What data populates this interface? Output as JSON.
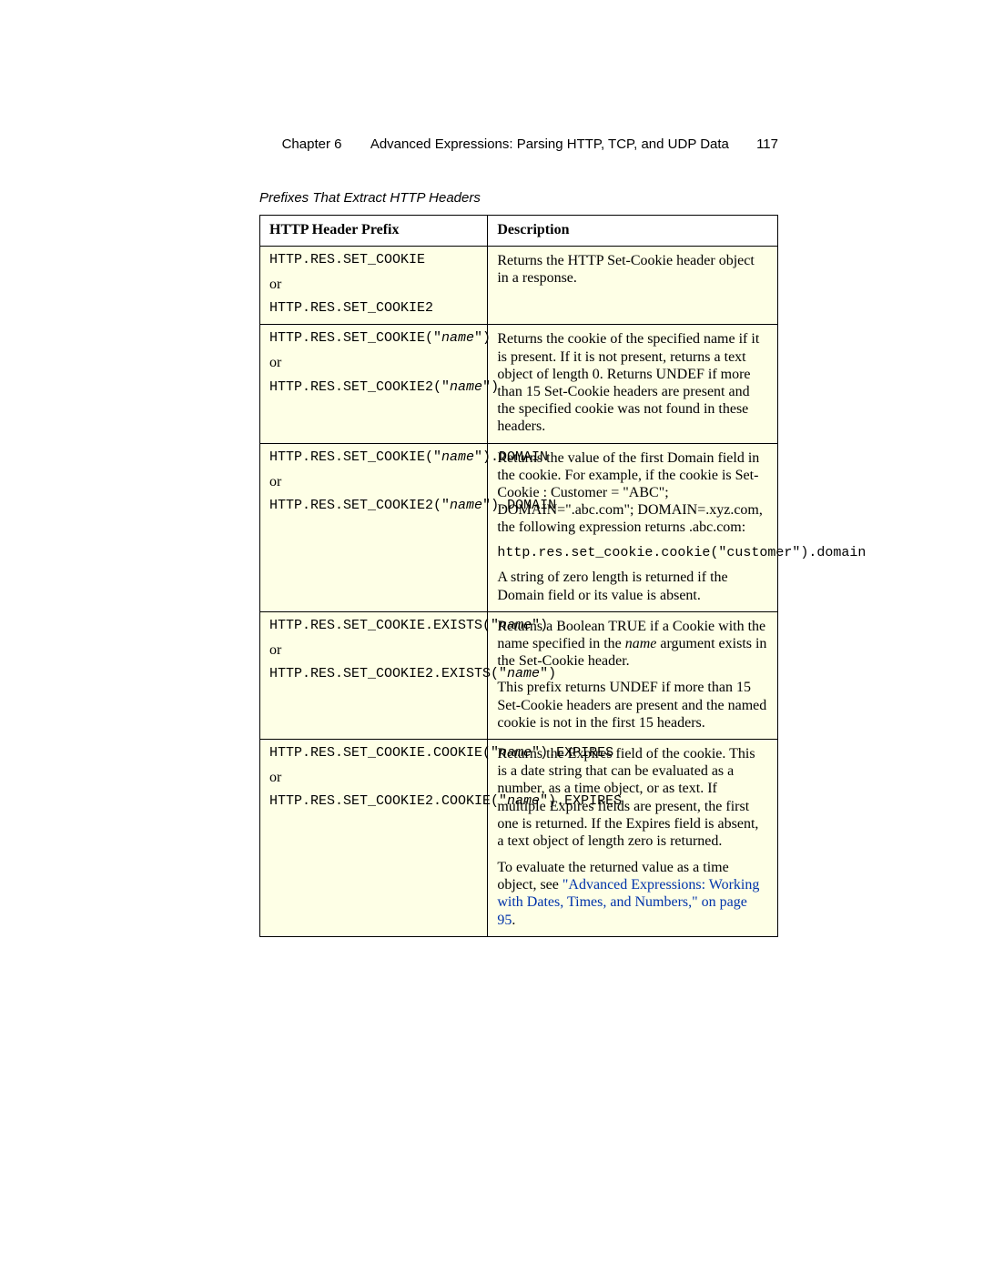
{
  "header": {
    "chapter": "Chapter 6",
    "title": "Advanced Expressions: Parsing HTTP, TCP, and UDP Data",
    "page": "117"
  },
  "caption": "Prefixes That Extract HTTP Headers",
  "columns": {
    "c1": "HTTP Header Prefix",
    "c2": "Description"
  },
  "rows": {
    "r1": {
      "code1": "HTTP.RES.SET_COOKIE",
      "or": "or",
      "code2": "HTTP.RES.SET_COOKIE2",
      "desc1": "Returns the HTTP Set-Cookie header object in a response."
    },
    "r2": {
      "code1a": "HTTP.RES.SET_COOKIE(\"",
      "code1n": "name",
      "code1b": "\")",
      "or": "or",
      "code2a": "HTTP.RES.SET_COOKIE2(\"",
      "code2n": "name",
      "code2b": "\")",
      "desc1": "Returns the cookie of the specified name if it is present. If it is not present, returns a text object of length 0. Returns UNDEF if more than 15 Set-Cookie headers are present and the specified cookie was not found in these headers."
    },
    "r3": {
      "code1a": "HTTP.RES.SET_COOKIE(\"",
      "code1n": "name",
      "code1b": "\").DOMAIN",
      "or": "or",
      "code2a": "HTTP.RES.SET_COOKIE2(\"",
      "code2n": "name",
      "code2b": "\").DOMAIN",
      "desc1": "Returns the value of the first Domain field in the cookie. For example, if the cookie is Set-Cookie : Customer = \"ABC\"; DOMAIN=\".abc.com\"; DOMAIN=.xyz.com, the following expression returns .abc.com:",
      "codeblock": "http.res.set_cookie.cookie(\"customer\").domain",
      "desc2": "A string of zero length is returned if the Domain field or its value is absent."
    },
    "r4": {
      "code1a": "HTTP.RES.SET_COOKIE.EXISTS(\"",
      "code1n": "name",
      "code1b": "\")",
      "or": "or",
      "code2a": "HTTP.RES.SET_COOKIE2.EXISTS(\"",
      "code2n": "name",
      "code2b": "\")",
      "desc1a": "Returns a Boolean TRUE if a Cookie with the name specified in the ",
      "desc1i": "name",
      "desc1b": " argument exists in the Set-Cookie header.",
      "desc2": "This prefix returns UNDEF if more than 15 Set-Cookie headers are present and the named cookie is not in the first 15 headers."
    },
    "r5": {
      "code1a": "HTTP.RES.SET_COOKIE.COOKIE(\"",
      "code1n": "name",
      "code1b": "\").EXPIRES",
      "or": "or",
      "code2a": "HTTP.RES.SET_COOKIE2.COOKIE(\"",
      "code2n": "name",
      "code2b": "\").EXPIRES",
      "desc1": "Returns the Expires field of the cookie. This is a date string that can be evaluated as a number, as a time object, or as text. If multiple Expires fields are present, the first one is returned. If the Expires field is absent, a text object of length zero is returned.",
      "desc2a": "To evaluate the returned value as a time object, see ",
      "linktext": "\"Advanced Expressions: Working with Dates, Times, and Numbers,\" on page 95",
      "desc2b": "."
    }
  }
}
